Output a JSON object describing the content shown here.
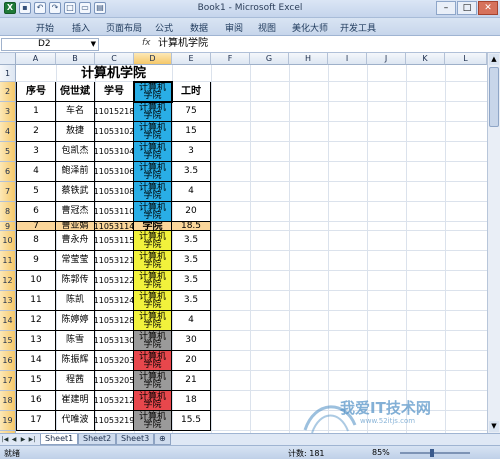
{
  "window": {
    "title": "Book1 - Microsoft Excel",
    "controls": [
      "–",
      "□",
      "✕"
    ]
  },
  "ribbon_tabs": [
    "开始",
    "插入",
    "页面布局",
    "公式",
    "数据",
    "审阅",
    "视图",
    "美化大师",
    "开发工具"
  ],
  "formula_bar": {
    "name_box": "D2",
    "fx_label": "fx",
    "value": "计算机学院"
  },
  "columns": [
    "A",
    "B",
    "C",
    "D",
    "E",
    "F",
    "G",
    "H",
    "I",
    "J",
    "K",
    "L"
  ],
  "rows": [
    "1",
    "2",
    "3",
    "4",
    "5",
    "6",
    "7",
    "8",
    "9",
    "10",
    "11",
    "12",
    "13",
    "14",
    "15",
    "16",
    "17",
    "18",
    "19",
    "20"
  ],
  "sheet": {
    "title": "计算机学院",
    "headers": [
      "序号",
      "倪世斌",
      "学号",
      "计算机学院",
      "工时"
    ],
    "records": [
      {
        "seq": "1",
        "name": "车名",
        "id": "11015218",
        "major": "计算机学院",
        "hours": "75"
      },
      {
        "seq": "2",
        "name": "敖捷",
        "id": "11053102",
        "major": "计算机学院",
        "hours": "15"
      },
      {
        "seq": "3",
        "name": "包凯杰",
        "id": "11053104",
        "major": "计算机学院",
        "hours": "3"
      },
      {
        "seq": "4",
        "name": "鲍泽前",
        "id": "11053106",
        "major": "计算机学院",
        "hours": "3.5"
      },
      {
        "seq": "5",
        "name": "蔡铁武",
        "id": "11053108",
        "major": "计算机学院",
        "hours": "4"
      },
      {
        "seq": "6",
        "name": "曹冠杰",
        "id": "11053110",
        "major": "计算机学院",
        "hours": "20"
      },
      {
        "seq": "7",
        "name": "曹亚娟",
        "id": "11053114",
        "major": "学院",
        "hours": "18.5"
      },
      {
        "seq": "8",
        "name": "曹永舟",
        "id": "11053115",
        "major": "计算机学院",
        "hours": "3.5"
      },
      {
        "seq": "9",
        "name": "常莹莹",
        "id": "11053121",
        "major": "计算机学院",
        "hours": "3.5"
      },
      {
        "seq": "10",
        "name": "陈郭传",
        "id": "11053122",
        "major": "计算机学院",
        "hours": "3.5"
      },
      {
        "seq": "11",
        "name": "陈凯",
        "id": "11053124",
        "major": "计算机学院",
        "hours": "3.5"
      },
      {
        "seq": "12",
        "name": "陈婷婷",
        "id": "11053128",
        "major": "计算机学院",
        "hours": "4"
      },
      {
        "seq": "13",
        "name": "陈雪",
        "id": "11053130",
        "major": "计算机学院",
        "hours": "30"
      },
      {
        "seq": "14",
        "name": "陈振辉",
        "id": "11053203",
        "major": "计算机学院",
        "hours": "20"
      },
      {
        "seq": "15",
        "name": "程茜",
        "id": "11053205",
        "major": "计算机学院",
        "hours": "21"
      },
      {
        "seq": "16",
        "name": "崔建明",
        "id": "11053212",
        "major": "计算机学院",
        "hours": "18"
      },
      {
        "seq": "17",
        "name": "代唯波",
        "id": "11053219",
        "major": "计算机学院",
        "hours": "15.5"
      }
    ]
  },
  "colors": {
    "major_blue": "#29aee6",
    "major_yellow": "#f2f23c",
    "major_red": "#e8474c",
    "major_gray": "#9a9a9a",
    "row_highlight": "#fbd69a",
    "selection_header": "#f5c869"
  },
  "sheet_tabs": [
    "Sheet1",
    "Sheet2",
    "Sheet3"
  ],
  "active_sheet": "Sheet1",
  "status": {
    "ready": "就绪",
    "count": "计数: 181",
    "zoom": "85%"
  },
  "watermark": {
    "text": "我爱IT技术网",
    "url": "www.52itjs.com"
  }
}
